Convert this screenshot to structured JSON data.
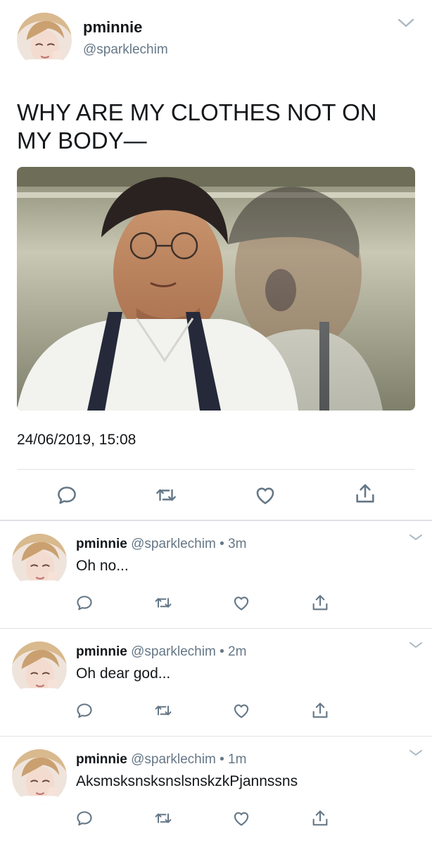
{
  "main_tweet": {
    "name": "pminnie",
    "handle": "@sparklechim",
    "text": "WHY ARE MY CLOTHES NOT ON MY BODY—",
    "timestamp": "24/06/2019, 15:08",
    "icons": {
      "menu": "chevron-down-icon",
      "reply": "comment-icon",
      "retweet": "retweet-icon",
      "like": "heart-icon",
      "share": "share-icon"
    }
  },
  "replies": [
    {
      "name": "pminnie",
      "handle": "@sparklechim",
      "separator": "•",
      "time": "3m",
      "text": "Oh no..."
    },
    {
      "name": "pminnie",
      "handle": "@sparklechim",
      "separator": "•",
      "time": "2m",
      "text": "Oh dear god..."
    },
    {
      "name": "pminnie",
      "handle": "@sparklechim",
      "separator": "•",
      "time": "1m",
      "text": "AksmsksnsksnslsnskzkPjannssns"
    }
  ],
  "colors": {
    "text": "#14171a",
    "secondary": "#657786",
    "divider": "#dfe3e6"
  }
}
